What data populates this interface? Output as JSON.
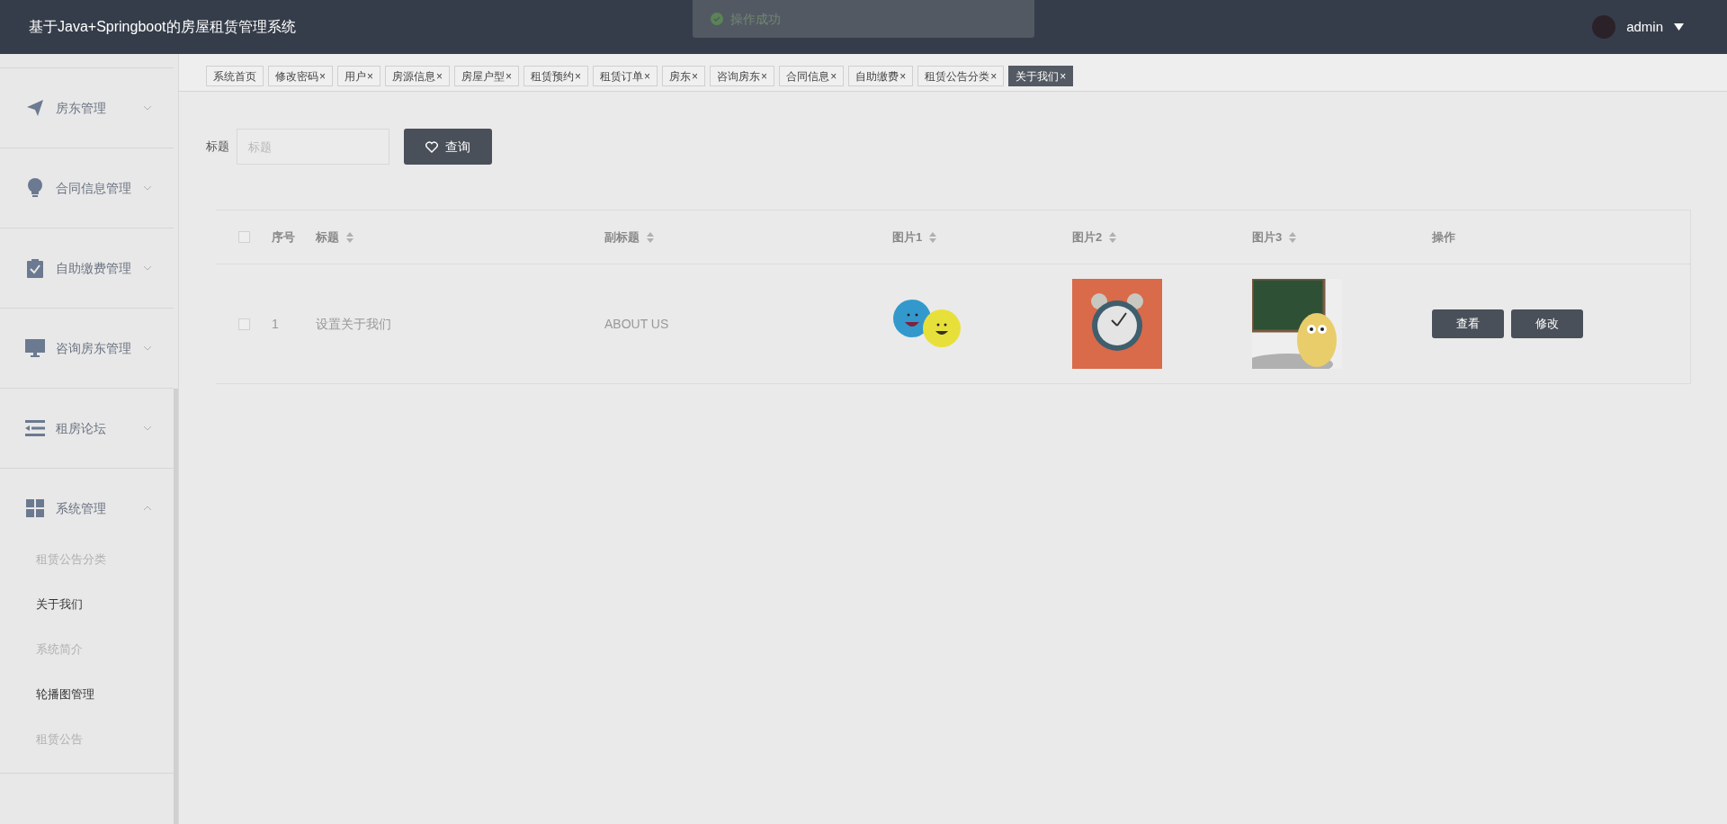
{
  "header": {
    "title": "基于Java+Springboot的房屋租赁管理系统",
    "user": "admin"
  },
  "toast": {
    "message": "操作成功"
  },
  "sidebar": {
    "items": [
      {
        "label": "房东管理",
        "kind": "plane",
        "expanded": false
      },
      {
        "label": "合同信息管理",
        "kind": "bulb",
        "expanded": false
      },
      {
        "label": "自助缴费管理",
        "kind": "clipboard",
        "expanded": false
      },
      {
        "label": "咨询房东管理",
        "kind": "monitor",
        "expanded": false
      },
      {
        "label": "租房论坛",
        "kind": "list",
        "expanded": false
      },
      {
        "label": "系统管理",
        "kind": "grid",
        "expanded": true,
        "children": [
          {
            "label": "租赁公告分类",
            "selected": false
          },
          {
            "label": "关于我们",
            "selected": true
          },
          {
            "label": "系统简介",
            "selected": false
          },
          {
            "label": "轮播图管理",
            "selected": true
          },
          {
            "label": "租赁公告",
            "selected": false
          }
        ]
      }
    ]
  },
  "tabs": [
    {
      "label": "系统首页",
      "closable": false,
      "selected": false
    },
    {
      "label": "修改密码",
      "closable": true,
      "selected": false
    },
    {
      "label": "用户",
      "closable": true,
      "selected": false
    },
    {
      "label": "房源信息",
      "closable": true,
      "selected": false
    },
    {
      "label": "房屋户型",
      "closable": true,
      "selected": false
    },
    {
      "label": "租赁预约",
      "closable": true,
      "selected": false
    },
    {
      "label": "租赁订单",
      "closable": true,
      "selected": false
    },
    {
      "label": "房东",
      "closable": true,
      "selected": false
    },
    {
      "label": "咨询房东",
      "closable": true,
      "selected": false
    },
    {
      "label": "合同信息",
      "closable": true,
      "selected": false
    },
    {
      "label": "自助缴费",
      "closable": true,
      "selected": false
    },
    {
      "label": "租赁公告分类",
      "closable": true,
      "selected": false
    },
    {
      "label": "关于我们",
      "closable": true,
      "selected": true
    }
  ],
  "close_glyph": "×",
  "search": {
    "label": "标题",
    "placeholder": "标题",
    "button": "查询"
  },
  "table": {
    "columns": [
      {
        "label": "序号",
        "sortable": false
      },
      {
        "label": "标题",
        "sortable": true
      },
      {
        "label": "副标题",
        "sortable": true
      },
      {
        "label": "图片1",
        "sortable": true
      },
      {
        "label": "图片2",
        "sortable": true
      },
      {
        "label": "图片3",
        "sortable": true
      },
      {
        "label": "操作",
        "sortable": false
      }
    ],
    "all_checked": false,
    "rows": [
      {
        "checked": false,
        "index": "1",
        "title": "设置关于我们",
        "subtitle": "ABOUT US",
        "actions": [
          "查看",
          "修改"
        ]
      }
    ]
  }
}
